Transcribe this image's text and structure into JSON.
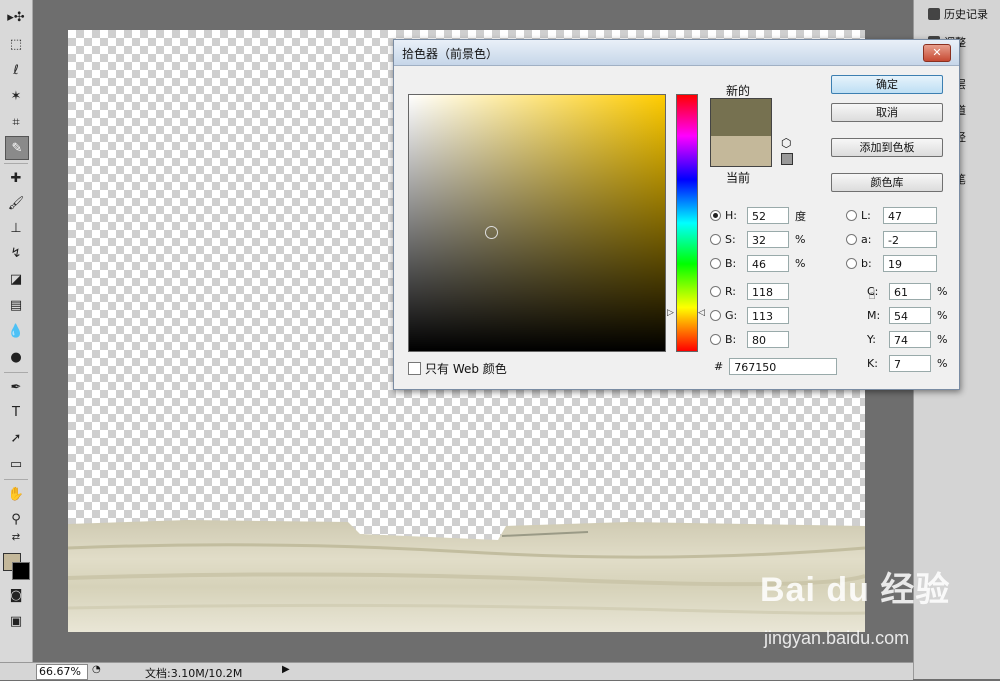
{
  "dialog": {
    "title": "拾色器（前景色）",
    "close": "✕",
    "new_label": "新的",
    "current_label": "当前",
    "web_only_label": "只有 Web 颜色",
    "buttons": [
      "确定",
      "取消",
      "添加到色板",
      "颜色库"
    ],
    "hsb": [
      {
        "label": "H:",
        "value": "52",
        "unit": "度",
        "selected": true
      },
      {
        "label": "S:",
        "value": "32",
        "unit": "%",
        "selected": false
      },
      {
        "label": "B:",
        "value": "46",
        "unit": "%",
        "selected": false
      }
    ],
    "rgb": [
      {
        "label": "R:",
        "value": "118"
      },
      {
        "label": "G:",
        "value": "113"
      },
      {
        "label": "B:",
        "value": "80"
      }
    ],
    "lab": [
      {
        "label": "L:",
        "value": "47"
      },
      {
        "label": "a:",
        "value": "-2"
      },
      {
        "label": "b:",
        "value": "19"
      }
    ],
    "cmyk": [
      {
        "label": "C:",
        "value": "61",
        "unit": "%"
      },
      {
        "label": "M:",
        "value": "54",
        "unit": "%"
      },
      {
        "label": "Y:",
        "value": "74",
        "unit": "%"
      },
      {
        "label": "K:",
        "value": "7",
        "unit": "%"
      }
    ],
    "hex_prefix": "#",
    "hex": "767150",
    "new_color": "#767150",
    "current_color": "#c4b89a"
  },
  "panels": [
    "历史记录",
    "调整",
    "图层",
    "通道",
    "路径",
    "画笔"
  ],
  "status": {
    "zoom": "66.67%",
    "doc": "文档:3.10M/10.2M"
  },
  "watermark": {
    "brand": "Bai du 经验",
    "url": "jingyan.baidu.com"
  }
}
